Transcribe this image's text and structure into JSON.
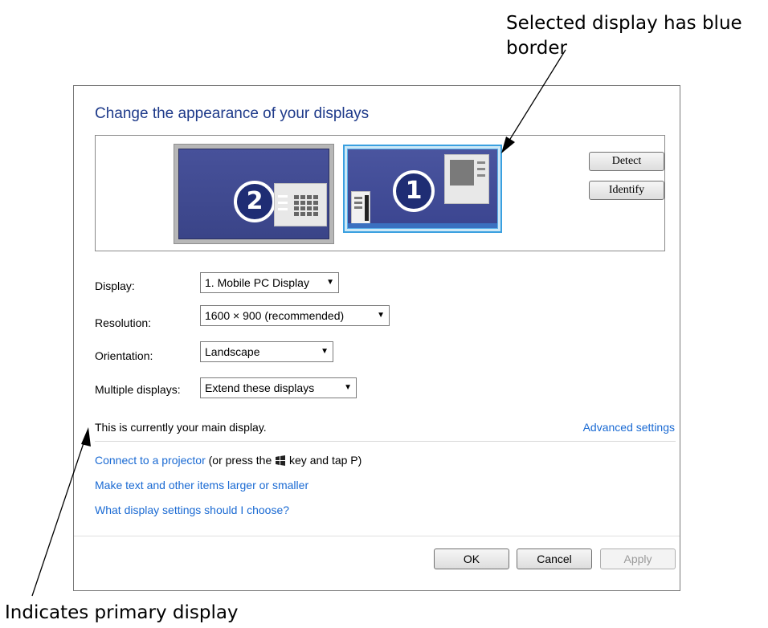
{
  "annotations": {
    "top_line1": "Selected display has blue",
    "top_line2": "border",
    "bottom": "Indicates primary display"
  },
  "dialog": {
    "title": "Change the appearance of your displays",
    "monitors": [
      {
        "number": "2",
        "selected": false
      },
      {
        "number": "1",
        "selected": true
      }
    ],
    "detect_label": "Detect",
    "identify_label": "Identify",
    "fields": {
      "display": {
        "label": "Display:",
        "value": "1. Mobile PC Display"
      },
      "resolution": {
        "label": "Resolution:",
        "value": "1600 × 900 (recommended)"
      },
      "orientation": {
        "label": "Orientation:",
        "value": "Landscape"
      },
      "multiple": {
        "label": "Multiple displays:",
        "value": "Extend these displays"
      }
    },
    "main_display_text": "This is currently your main display.",
    "advanced_settings": "Advanced settings",
    "projector_link": "Connect to a projector",
    "projector_suffix_1": "(or press the",
    "projector_suffix_2": "key and tap P)",
    "text_size_link": "Make text and other items larger or smaller",
    "help_link": "What display settings should I choose?",
    "ok_label": "OK",
    "cancel_label": "Cancel",
    "apply_label": "Apply"
  },
  "colors": {
    "selected_border": "#3aa0e0",
    "link": "#1a6ad3",
    "title": "#1e3a8a"
  }
}
